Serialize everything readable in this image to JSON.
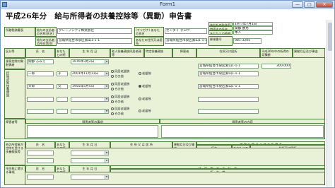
{
  "window": {
    "title": "Form1",
    "min": "—",
    "max": "□",
    "close": "✕"
  },
  "form": {
    "title": "平成26年分　給与所得者の扶養控除等（異動）申告書",
    "office_label": "所轄税務署長",
    "payer_name_label": "給与の支払者の名称(氏名)",
    "payer_name": "グレープシティ株式会社",
    "payer_addr_label": "給与の支払者の所在地(住所)",
    "payer_addr": "宮城県仙台市泉区紫山1-1-1",
    "furigana_label": "(フリガナ) あなたの氏名",
    "furigana": "センダイ タロウ",
    "your_addr_label": "あなたの住所又は居所",
    "your_addr": "宮城県仙台市泉区紫山1-1-1",
    "birth_label": "あなたの生年月日",
    "birth": "1977年7月1日",
    "head_label": "世帯主の氏名",
    "head": "関都 勝男",
    "relation_label": "あなたとの続柄",
    "relation": "本人",
    "postal_label": "郵便番号",
    "postal": "981-3205"
  },
  "columns": {
    "section": "区分等",
    "name": "氏　名",
    "relation": "あなたとの続柄",
    "birth": "生 年 月 日",
    "cohabit": "老人扶養親族同居老親等",
    "special": "特定扶養親族",
    "handicap": "障害者",
    "address": "住所又は居所",
    "income": "平成26年中の所得の見積額",
    "change": "異動月日及び事由"
  },
  "spouse": {
    "label": "源泉控除対象配偶者",
    "name": "関都 ふみえ",
    "birth": "1976年3月2日",
    "address": "宮城県仙台市泉区紫山1-1-1",
    "income": "300,000"
  },
  "dependents_label": "控除対象扶養親族",
  "dependents": [
    {
      "name": "一郎",
      "relation": "子",
      "birth": "2001年11月11日",
      "opt1": "同居老親等",
      "opt2": "その他",
      "opt3": "老親等",
      "address": "宮城県仙台市泉区紫山1-1-1"
    },
    {
      "name": "大郎",
      "relation": "父",
      "birth": "1955年5月5日",
      "opt1": "同居老親等",
      "opt2": "その他",
      "opt3": "老親等",
      "address": "宮城県仙台市泉区紫山1-1-1"
    },
    {
      "name": "",
      "relation": "",
      "birth": "",
      "opt1": "同居老親等",
      "opt2": "その他",
      "opt3": "老親等",
      "address": ""
    },
    {
      "name": "",
      "relation": "",
      "birth": "",
      "opt1": "同居老親等",
      "opt2": "その他",
      "opt3": "老親等",
      "address": ""
    }
  ],
  "handicap_section": {
    "label": "障害者等",
    "col1": "障害者等の事項",
    "col2": "障害者等の内容"
  },
  "lower": {
    "label1": "他の所得者が控除を受ける扶養親族等",
    "label2": "住民税に関する事項",
    "col_name": "氏　名",
    "col_relation": "あなたとの続柄",
    "col_birth": "生 年 月 日",
    "col_addr": "住 所 又 は 居 所",
    "col_change": "異動月日及び事由",
    "col_other": "控 除 を 受 け る 他 の 所 得 者",
    "col_other_name": "氏名",
    "col_other_rel": "あなたとの続柄",
    "col_other_addr": "住所又は居所",
    "col_recipient": "住　民　税　の　支　払　者",
    "col_recipient2": "所　在　地"
  }
}
